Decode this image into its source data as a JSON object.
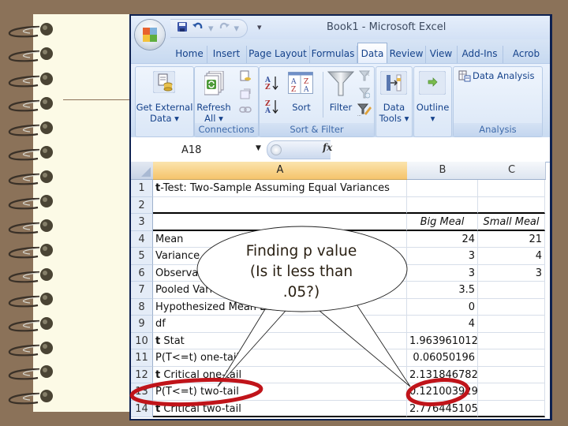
{
  "window": {
    "title": "Book1  -  Microsoft Excel",
    "qat": {
      "save_icon": "save-icon",
      "undo_icon": "undo-icon",
      "redo_icon": "redo-icon",
      "more": "▾"
    }
  },
  "tabs": [
    {
      "label": "Home",
      "active": false
    },
    {
      "label": "Insert",
      "active": false
    },
    {
      "label": "Page Layout",
      "active": false
    },
    {
      "label": "Formulas",
      "active": false
    },
    {
      "label": "Data",
      "active": true
    },
    {
      "label": "Review",
      "active": false
    },
    {
      "label": "View",
      "active": false
    },
    {
      "label": "Add-Ins",
      "active": false
    },
    {
      "label": "Acrob",
      "active": false
    }
  ],
  "ribbon": {
    "get_external": {
      "line1": "Get External",
      "line2": "Data ▾"
    },
    "connections": {
      "refresh_line1": "Refresh",
      "refresh_line2": "All ▾",
      "group_label": "Connections"
    },
    "sort_filter": {
      "sort_label": "Sort",
      "filter_label": "Filter",
      "group_label": "Sort & Filter",
      "az": "A\nZ",
      "za": "Z\nA"
    },
    "data_tools": {
      "line1": "Data",
      "line2": "Tools ▾"
    },
    "outline": {
      "line1": "Outline",
      "line2": "▾"
    },
    "analysis": {
      "data_analysis": "Data Analysis",
      "group_label": "Analysis"
    }
  },
  "formula_bar": {
    "name_box": "A18",
    "fx": "fx",
    "formula": ""
  },
  "columns": [
    "A",
    "B",
    "C"
  ],
  "selected_column": "A",
  "rows": [
    {
      "n": "1",
      "a_bold": "t",
      "a": "-Test: Two-Sample Assuming Equal Variances",
      "b": "",
      "c": ""
    },
    {
      "n": "2",
      "a_bold": "",
      "a": "",
      "b": "",
      "c": ""
    },
    {
      "n": "3",
      "a_bold": "",
      "a": "",
      "b": "Big Meal",
      "c": "Small Meal"
    },
    {
      "n": "4",
      "a_bold": "",
      "a": "Mean",
      "b": "24",
      "c": "21"
    },
    {
      "n": "5",
      "a_bold": "",
      "a": "Variance",
      "b": "3",
      "c": "4"
    },
    {
      "n": "6",
      "a_bold": "",
      "a": "Observations",
      "b": "3",
      "c": "3"
    },
    {
      "n": "7",
      "a_bold": "",
      "a": "Pooled Variance",
      "b": "3.5",
      "c": ""
    },
    {
      "n": "8",
      "a_bold": "",
      "a": "Hypothesized Mean Difference",
      "b": "0",
      "c": ""
    },
    {
      "n": "9",
      "a_bold": "",
      "a": "df",
      "b": "4",
      "c": ""
    },
    {
      "n": "10",
      "a_bold": "t",
      "a": " Stat",
      "b": "1.963961012",
      "c": ""
    },
    {
      "n": "11",
      "a_bold": "",
      "a": "P(T<=t) one-tail",
      "b": "0.06050196",
      "c": ""
    },
    {
      "n": "12",
      "a_bold": "t",
      "a": " Critical one-tail",
      "b": "2.131846782",
      "c": ""
    },
    {
      "n": "13",
      "a_bold": "",
      "a": "P(T<=t) two-tail",
      "b": "0.121003929",
      "c": ""
    },
    {
      "n": "14",
      "a_bold": "t",
      "a": " Critical two-tail",
      "b": "2.776445105",
      "c": ""
    }
  ],
  "callout": {
    "line1": "Finding p value",
    "line2": "(Is it less than",
    "line3": ".05?)"
  },
  "annotations": {
    "highlight_color": "#c0141a",
    "highlighted_label": "P(T<=t) two-tail",
    "highlighted_value": "0.121003929"
  },
  "colors": {
    "background": "#8b7259",
    "paper": "#fcfae6",
    "window_border": "#0e2150",
    "ribbon_text": "#15428b",
    "selected_column": "#f5c46c"
  }
}
